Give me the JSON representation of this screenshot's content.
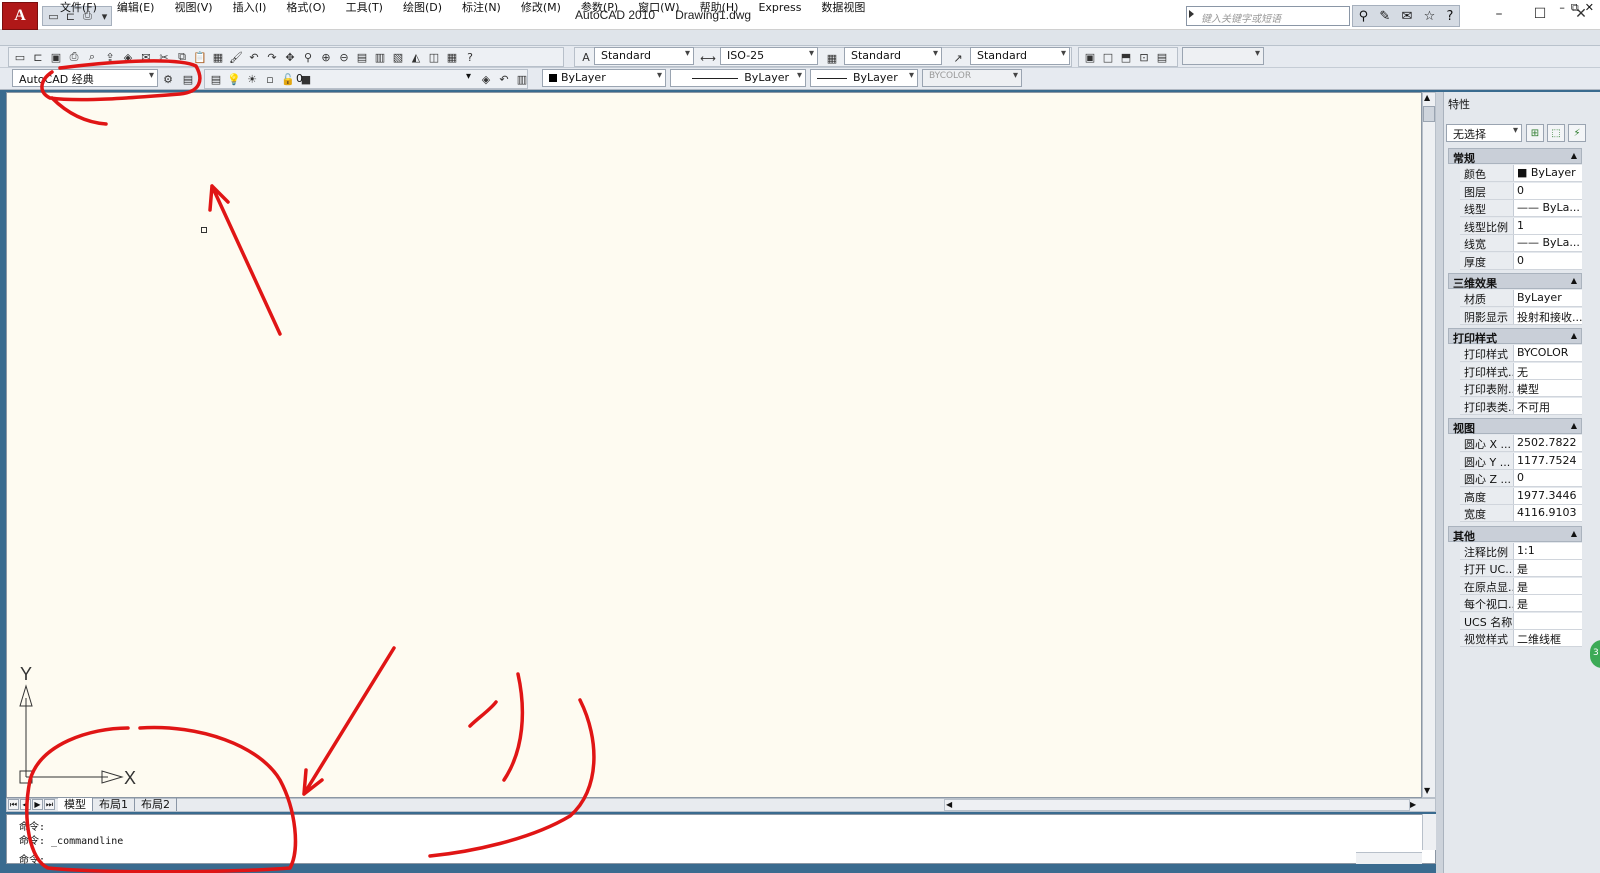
{
  "app": {
    "logo_letter": "A",
    "title": "AutoCAD 2010",
    "document": "Drawing1.dwg",
    "search_placeholder": "键入关键字或短语"
  },
  "window_controls": {
    "minimize": "–",
    "maximize": "☐",
    "close": "✕"
  },
  "mdi_controls": {
    "minimize": "–",
    "restore": "⧉",
    "close": "✕"
  },
  "menu": [
    "文件(F)",
    "编辑(E)",
    "视图(V)",
    "插入(I)",
    "格式(O)",
    "工具(T)",
    "绘图(D)",
    "标注(N)",
    "修改(M)",
    "参数(P)",
    "窗口(W)",
    "帮助(H)",
    "Express",
    "数据视图"
  ],
  "toolbar1": {
    "text_style": "Standard",
    "dim_style": "ISO-25",
    "table_style": "Standard",
    "mleader_style": "Standard"
  },
  "toolbar2": {
    "workspace": "AutoCAD 经典",
    "layer": "0",
    "color": "ByLayer",
    "linetype": "ByLayer",
    "lineweight": "ByLayer",
    "plotstyle": "BYCOLOR"
  },
  "ucs": {
    "y": "Y",
    "x": "X"
  },
  "layout_tabs": [
    "模型",
    "布局1",
    "布局2"
  ],
  "command": {
    "line1": "命令:",
    "line2": "命令: _commandline",
    "prompt": "命令:"
  },
  "palette": {
    "title": "特性",
    "selection": "无选择",
    "sections": [
      {
        "name": "常规",
        "rows": [
          {
            "k": "颜色",
            "v": "■ ByLayer"
          },
          {
            "k": "图层",
            "v": "0"
          },
          {
            "k": "线型",
            "v": "—— ByLa..."
          },
          {
            "k": "线型比例",
            "v": "1"
          },
          {
            "k": "线宽",
            "v": "—— ByLa..."
          },
          {
            "k": "厚度",
            "v": "0"
          }
        ]
      },
      {
        "name": "三维效果",
        "rows": [
          {
            "k": "材质",
            "v": "ByLayer"
          },
          {
            "k": "阴影显示",
            "v": "投射和接收..."
          }
        ]
      },
      {
        "name": "打印样式",
        "rows": [
          {
            "k": "打印样式",
            "v": "BYCOLOR"
          },
          {
            "k": "打印样式...",
            "v": "无"
          },
          {
            "k": "打印表附...",
            "v": "模型"
          },
          {
            "k": "打印表类...",
            "v": "不可用"
          }
        ]
      },
      {
        "name": "视图",
        "rows": [
          {
            "k": "圆心 X ...",
            "v": "2502.7822"
          },
          {
            "k": "圆心 Y ...",
            "v": "1177.7524"
          },
          {
            "k": "圆心 Z ...",
            "v": "0"
          },
          {
            "k": "高度",
            "v": "1977.3446"
          },
          {
            "k": "宽度",
            "v": "4116.9103"
          }
        ]
      },
      {
        "name": "其他",
        "rows": [
          {
            "k": "注释比例",
            "v": "1:1"
          },
          {
            "k": "打开 UC...",
            "v": "是"
          },
          {
            "k": "在原点显...",
            "v": "是"
          },
          {
            "k": "每个视口...",
            "v": "是"
          },
          {
            "k": "UCS 名称",
            "v": ""
          },
          {
            "k": "视觉样式",
            "v": "二维线框"
          }
        ]
      }
    ]
  },
  "colors": {
    "canvas": "#fefbf1",
    "annotation": "#e01515",
    "logo": "#b01818"
  }
}
